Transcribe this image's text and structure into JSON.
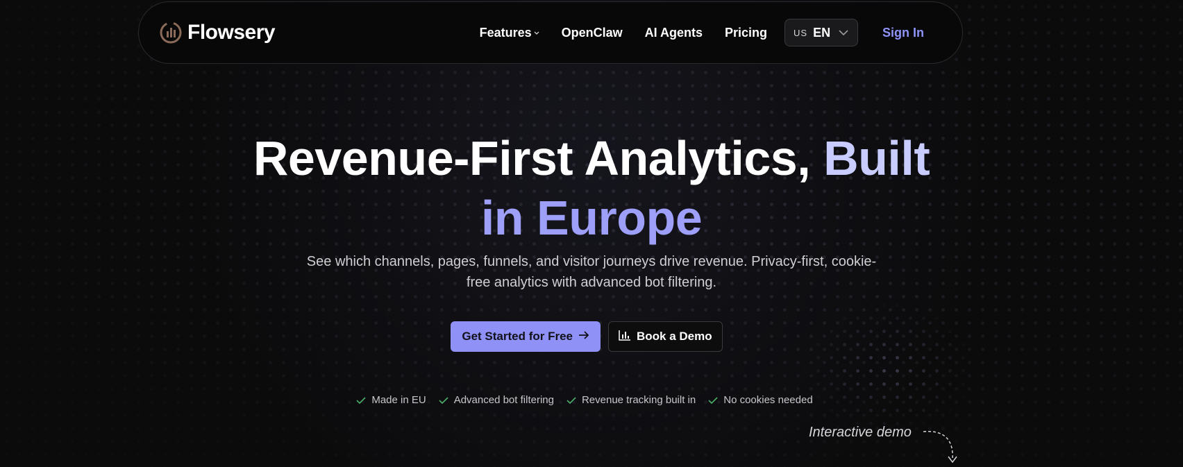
{
  "brand": {
    "name": "Flowsery",
    "logo_icon": "bar-chart-circle-icon",
    "logo_color": "#8a6a58"
  },
  "nav": {
    "links": [
      {
        "label": "Features",
        "has_dropdown": true
      },
      {
        "label": "OpenClaw"
      },
      {
        "label": "AI Agents"
      },
      {
        "label": "Pricing"
      }
    ],
    "language": {
      "flag": "US",
      "code": "EN"
    },
    "sign_in": "Sign In"
  },
  "hero": {
    "title_white": "Revenue-First Analytics,",
    "title_accent_1": "Built",
    "title_accent_2": "in Europe",
    "subtitle_line1": "See which channels, pages, funnels, and visitor journeys drive revenue. Privacy-first, cookie-",
    "subtitle_line2": "free analytics with advanced bot filtering.",
    "cta_primary": "Get Started for Free",
    "cta_secondary": "Book a Demo",
    "features": [
      "Made in EU",
      "Advanced bot filtering",
      "Revenue tracking built in",
      "No cookies needed"
    ],
    "demo_label": "Interactive demo"
  },
  "colors": {
    "accent": "#8f91f7",
    "accent_light": "#c9ccff",
    "check": "#4caf6a",
    "background": "#0b0b0c"
  }
}
